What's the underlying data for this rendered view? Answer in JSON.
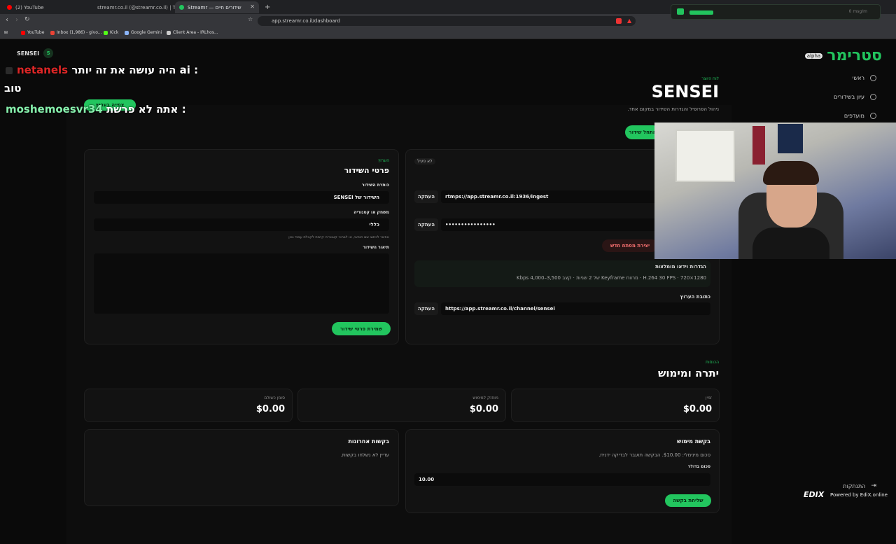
{
  "browser": {
    "tabs": [
      {
        "label": "(2) YouTube",
        "color": "#ff0000"
      },
      {
        "label": "streamr.co.il (@streamr.co.il) | TikTok",
        "color": "#ffffff"
      },
      {
        "label": "Streamr — שידורים חיים",
        "color": "#22c55e"
      }
    ],
    "url": "app.streamr.co.il/dashboard",
    "bookmarks": [
      {
        "label": "YouTube",
        "color": "#ff0000"
      },
      {
        "label": "Inbox (1,986) - givo...",
        "color": "#ea4335"
      },
      {
        "label": "Kick",
        "color": "#53fc18"
      },
      {
        "label": "Google Gemini",
        "color": "#8ab4f8"
      },
      {
        "label": "Client Area - IRLhos...",
        "color": "#cccccc"
      }
    ]
  },
  "widget": {
    "msg": "0 msg/m"
  },
  "logo": {
    "text": "סטרימר",
    "badge": "alpha"
  },
  "sidebar": {
    "items": [
      {
        "label": "ראשי",
        "icon": "home-icon"
      },
      {
        "label": "עיון בשידורים",
        "icon": "compass-icon"
      },
      {
        "label": "מועדפים",
        "icon": "heart-icon"
      }
    ],
    "logout": "התנתקות"
  },
  "topbar": {
    "user": "SENSEI",
    "avatar": "S"
  },
  "chat": {
    "line1_user": "netanels",
    "line1_text": ": ai היה עושה את זה יותר",
    "line2": "טוב",
    "line3_user": "moshemoesvr34",
    "line3_text": ": אתה לא פרשת"
  },
  "header": {
    "eyebrow": "לוח היוצר",
    "title": "SENSEI",
    "subtitle": "ניהול הפרופיל והגדרות השידור במקום אחד.",
    "start_button": "התחל שידור",
    "watch_button": "צפייה בערוץ"
  },
  "stream_card": {
    "status": "לא פעיל",
    "server_url": "rtmps://app.streamr.co.il:1936/ingest",
    "stream_key": "••••••••••••••••",
    "copy": "העתקה",
    "new_key": "יצירת מפתח חדש",
    "recommended_title": "הגדרות וידאו מומלצות",
    "recommended_text": "1280×720 · H.264 30 FPS · מרווח Keyframe של 2 שניות · קצב 3,500–4,000 Kbps",
    "channel_label": "כתובת הערוץ",
    "channel_url": "https://app.streamr.co.il/channel/sensei"
  },
  "details_card": {
    "eyebrow": "הערוץ",
    "title": "פרטי השידור",
    "title_label": "כותרת השידור",
    "title_value": "השידור של SENSEI",
    "game_label": "משחק או קטגוריה",
    "game_value": "כללי",
    "hint": "אפשר לכתוב שם חופשי, או לבחור קטגוריה קיימת לקבלת עמוד נכון",
    "desc_label": "תיאור השידור",
    "save": "שמירת פרטי שידור"
  },
  "balance": {
    "eyebrow": "הכנסות",
    "title": "יתרה ומימוש",
    "cards": [
      {
        "label": "זמין",
        "value": "$0.00"
      },
      {
        "label": "מוחזק למימוש",
        "value": "$0.00"
      },
      {
        "label": "סומן כשולם",
        "value": "$0.00"
      }
    ]
  },
  "withdraw": {
    "title": "בקשת מימוש",
    "text": "סכום מינימלי: $10.00. הבקשה תועבר לבדיקה ידנית.",
    "amount_label": "סכום בדולר",
    "amount_value": "10.00",
    "send": "שליחת בקשה"
  },
  "recent": {
    "title": "בקשות אחרונות",
    "empty": "עדיין לא נשלחו בקשות."
  },
  "footer": {
    "brand": "EDIX",
    "powered": "Powered by EdiX.online"
  }
}
